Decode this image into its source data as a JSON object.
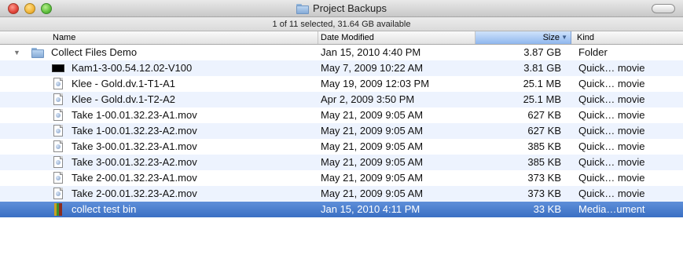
{
  "window": {
    "title": "Project Backups"
  },
  "status": "1 of 11 selected, 31.64 GB available",
  "columns": {
    "name": "Name",
    "date": "Date Modified",
    "size": "Size",
    "kind": "Kind",
    "sort_indicator": "▼"
  },
  "rows": [
    {
      "name": "Collect Files Demo",
      "date": "Jan 15, 2010 4:40 PM",
      "size": "3.87 GB",
      "kind": "Folder",
      "icon": "folder-icon"
    },
    {
      "name": "Kam1-3-00.54.12.02-V100",
      "date": "May 7, 2009 10:22 AM",
      "size": "3.81 GB",
      "kind": "Quick… movie",
      "icon": "movie-thumbnail-icon"
    },
    {
      "name": "Klee - Gold.dv.1-T1-A1",
      "date": "May 19, 2009 12:03 PM",
      "size": "25.1 MB",
      "kind": "Quick… movie",
      "icon": "document-icon"
    },
    {
      "name": "Klee - Gold.dv.1-T2-A2",
      "date": "Apr 2, 2009 3:50 PM",
      "size": "25.1 MB",
      "kind": "Quick… movie",
      "icon": "document-icon"
    },
    {
      "name": "Take 1-00.01.32.23-A1.mov",
      "date": "May 21, 2009 9:05 AM",
      "size": "627 KB",
      "kind": "Quick… movie",
      "icon": "document-icon"
    },
    {
      "name": "Take 1-00.01.32.23-A2.mov",
      "date": "May 21, 2009 9:05 AM",
      "size": "627 KB",
      "kind": "Quick… movie",
      "icon": "document-icon"
    },
    {
      "name": "Take 3-00.01.32.23-A1.mov",
      "date": "May 21, 2009 9:05 AM",
      "size": "385 KB",
      "kind": "Quick… movie",
      "icon": "document-icon"
    },
    {
      "name": "Take 3-00.01.32.23-A2.mov",
      "date": "May 21, 2009 9:05 AM",
      "size": "385 KB",
      "kind": "Quick… movie",
      "icon": "document-icon"
    },
    {
      "name": "Take 2-00.01.32.23-A1.mov",
      "date": "May 21, 2009 9:05 AM",
      "size": "373 KB",
      "kind": "Quick… movie",
      "icon": "document-icon"
    },
    {
      "name": "Take 2-00.01.32.23-A2.mov",
      "date": "May 21, 2009 9:05 AM",
      "size": "373 KB",
      "kind": "Quick… movie",
      "icon": "document-icon"
    },
    {
      "name": "collect test bin",
      "date": "Jan 15, 2010 4:11 PM",
      "size": "33 KB",
      "kind": "Media…ument",
      "icon": "bin-document-icon",
      "selected": true
    }
  ],
  "colors": {
    "selection": "#3a6fc3",
    "alternate_row": "#edf3fe",
    "sorted_header": "#8fb7ee"
  }
}
